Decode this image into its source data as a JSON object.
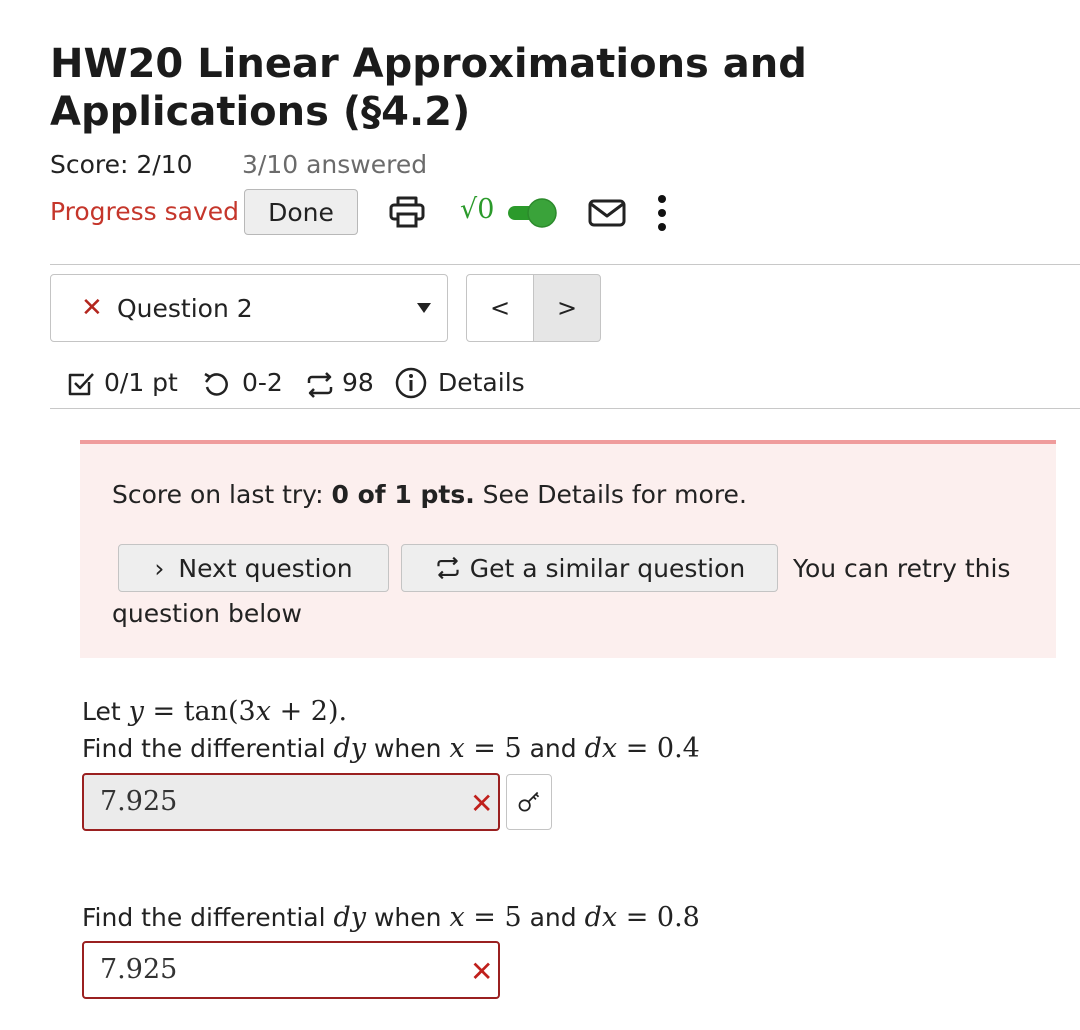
{
  "header": {
    "title": "HW20 Linear Approximations and Applications (§4.2)",
    "score": "Score: 2/10",
    "answered": "3/10 answered",
    "progress": "Progress saved",
    "done_label": "Done",
    "sqrt_label": "√0"
  },
  "nav": {
    "question_label": "Question 2",
    "question_status_symbol": "✕",
    "prev_label": "<",
    "next_label": ">"
  },
  "meta": {
    "points": "0/1 pt",
    "attempts": "0-2",
    "versions": "98",
    "details": "Details"
  },
  "alert": {
    "prefix": "Score on last try: ",
    "score": "0 of 1 pts.",
    "suffix": " See Details for more.",
    "next_question": "Next question",
    "similar_question": "Get a similar question",
    "retry_line1": "You can retry this",
    "retry_line2": "question below"
  },
  "question": {
    "let_prefix": "Let ",
    "y": "y",
    "eq": " = ",
    "expr_tan": "tan(3",
    "expr_x": "x",
    "expr_rest": " + 2).",
    "part1": {
      "find": "Find the differential ",
      "dy": "dy",
      "when": " when ",
      "x": "x",
      "x_val": " = 5",
      "and": " and ",
      "dx": "dx",
      "dx_val": " = 0.4",
      "answer": "7.925"
    },
    "part2": {
      "find": "Find the differential ",
      "dy": "dy",
      "when": " when ",
      "x": "x",
      "x_val": " = 5",
      "and": " and ",
      "dx": "dx",
      "dx_val": " = 0.8",
      "answer": "7.925"
    }
  },
  "colors": {
    "error_red": "#c5362b",
    "toggle_green": "#2b9a2b",
    "alert_bg": "#fcefee",
    "alert_border": "#ef9c9c"
  },
  "icons": [
    "print-icon",
    "sqrt-icon",
    "toggle-switch",
    "mail-icon",
    "more-vert-icon",
    "checkbox-icon",
    "retry-icon",
    "shuffle-icon",
    "info-icon",
    "key-icon",
    "wrong-x-icon"
  ]
}
